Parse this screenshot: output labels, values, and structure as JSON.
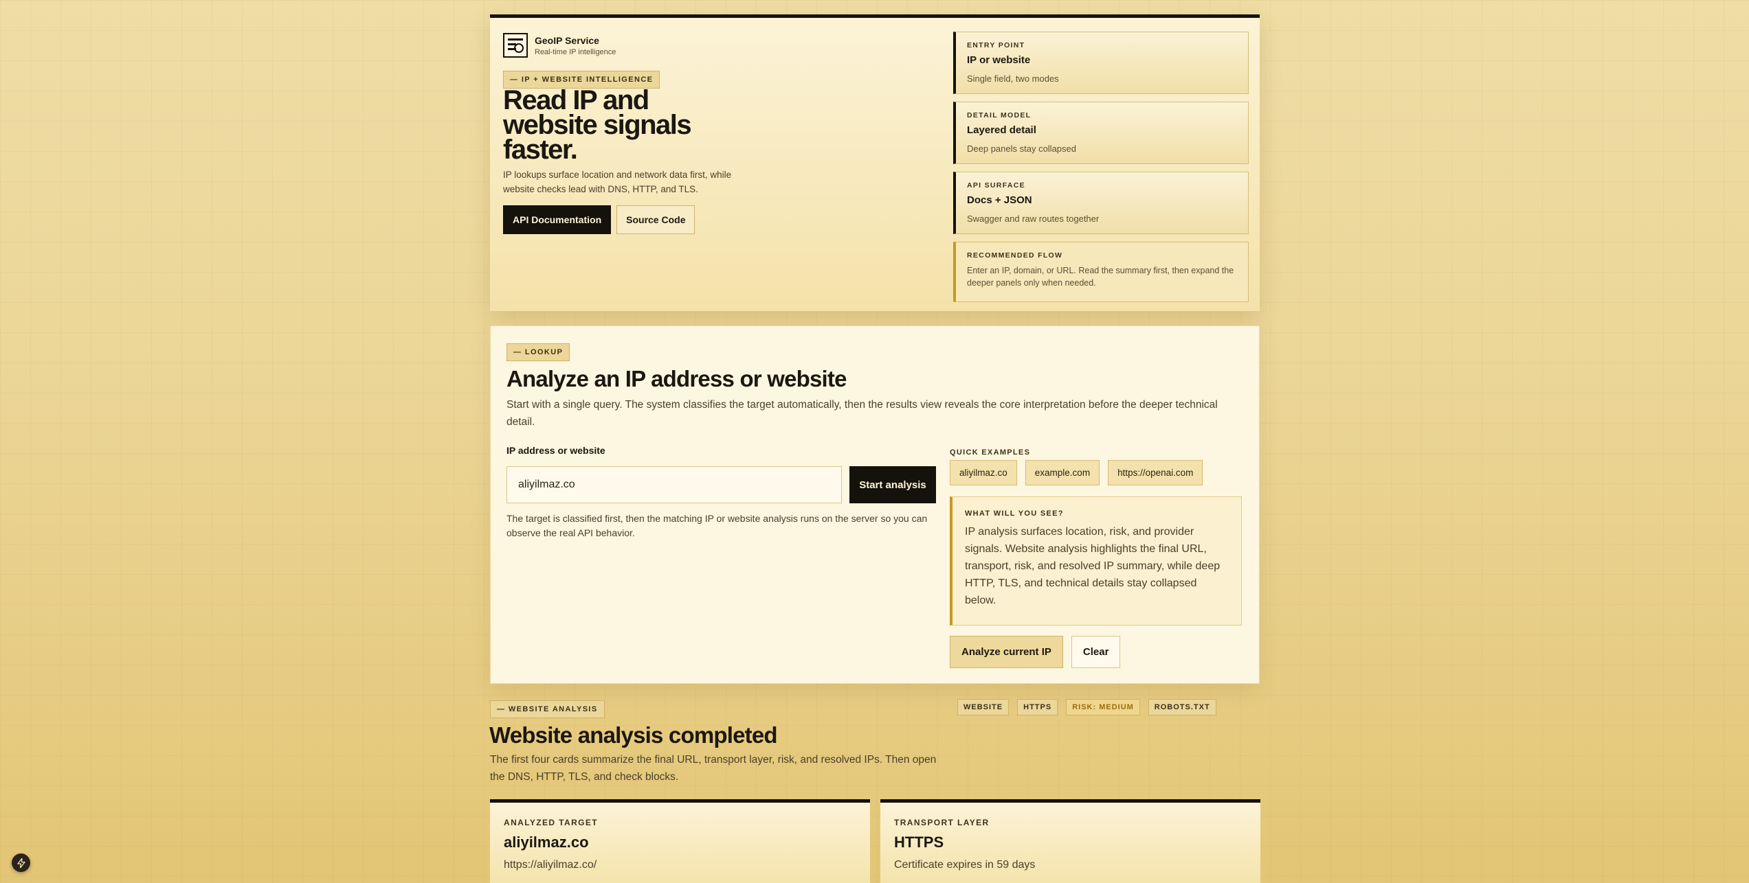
{
  "brand": {
    "name": "GeoIP Service",
    "subtitle": "Real-time IP intelligence"
  },
  "hero": {
    "eyebrow": "— IP + WEBSITE INTELLIGENCE",
    "title": "Read IP and website signals faster.",
    "description": "IP lookups surface location and network data first, while website checks lead with DNS, HTTP, and TLS.",
    "api_docs_label": "API Documentation",
    "source_code_label": "Source Code",
    "cards": [
      {
        "label": "ENTRY POINT",
        "value": "IP or website",
        "sub": "Single field, two modes"
      },
      {
        "label": "DETAIL MODEL",
        "value": "Layered detail",
        "sub": "Deep panels stay collapsed"
      },
      {
        "label": "API SURFACE",
        "value": "Docs + JSON",
        "sub": "Swagger and raw routes together"
      }
    ],
    "flow": {
      "label": "RECOMMENDED FLOW",
      "text": "Enter an IP, domain, or URL. Read the summary first, then expand the deeper panels only when needed."
    }
  },
  "lookup": {
    "eyebrow": "— LOOKUP",
    "title": "Analyze an IP address or website",
    "description": "Start with a single query. The system classifies the target automatically, then the results view reveals the core interpretation before the deeper technical detail.",
    "field_label": "IP address or website",
    "query_value": "aliyilmaz.co",
    "start_label": "Start analysis",
    "hint": "The target is classified first, then the matching IP or website analysis runs on the server so you can observe the real API behavior.",
    "quick_examples_label": "QUICK EXAMPLES",
    "quick_examples": [
      "aliyilmaz.co",
      "example.com",
      "https://openai.com"
    ],
    "what_label": "WHAT WILL YOU SEE?",
    "what_text": "IP analysis surfaces location, risk, and provider signals. Website analysis highlights the final URL, transport, risk, and resolved IP summary, while deep HTTP, TLS, and technical details stay collapsed below.",
    "analyze_current_label": "Analyze current IP",
    "clear_label": "Clear"
  },
  "results": {
    "eyebrow": "— WEBSITE ANALYSIS",
    "badges": [
      "WEBSITE",
      "HTTPS",
      "RISK: MEDIUM",
      "ROBOTS.TXT"
    ],
    "title": "Website analysis completed",
    "description": "The first four cards summarize the final URL, transport layer, risk, and resolved IPs. Then open the DNS, HTTP, TLS, and check blocks.",
    "cards": [
      {
        "label": "ANALYZED TARGET",
        "value": "aliyilmaz.co",
        "sub": "https://aliyilmaz.co/"
      },
      {
        "label": "TRANSPORT LAYER",
        "value": "HTTPS",
        "sub": "Certificate expires in 59 days"
      }
    ]
  },
  "icons": {
    "brand": "globe-lens-icon",
    "corner": "bolt-icon"
  },
  "colors": {
    "ink": "#15110b",
    "accent": "#c49b22",
    "paper": "#fdf6e0",
    "background": "#ebd596"
  }
}
